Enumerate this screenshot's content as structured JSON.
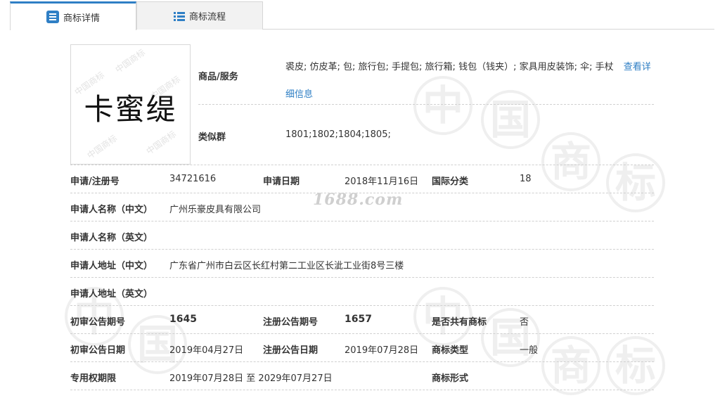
{
  "tabs": [
    {
      "label": "商标详情",
      "active": true
    },
    {
      "label": "商标流程",
      "active": false
    }
  ],
  "logo": {
    "text": "卡蜜缇",
    "watermark": "中国商标"
  },
  "background_watermark": [
    "中",
    "国",
    "商",
    "标"
  ],
  "site_watermark": "1688.com",
  "goods": {
    "label": "商品/服务",
    "value": "裘皮; 仿皮革; 包; 旅行包; 手提包; 旅行箱; 钱包（钱夹）; 家具用皮装饰; 伞; 手杖",
    "link": "查看详细信息"
  },
  "similar_group": {
    "label": "类似群",
    "value": "1801;1802;1804;1805;"
  },
  "rows": {
    "reg_no": {
      "label": "申请/注册号",
      "value": "34721616"
    },
    "apply_date": {
      "label": "申请日期",
      "value": "2018年11月16日"
    },
    "intl_class": {
      "label": "国际分类",
      "value": "18"
    },
    "applicant_cn": {
      "label": "申请人名称（中文）",
      "value": "广州乐豪皮具有限公司"
    },
    "applicant_en": {
      "label": "申请人名称（英文）",
      "value": ""
    },
    "address_cn": {
      "label": "申请人地址（中文）",
      "value": "广东省广州市白云区长红村第二工业区长泚工业街8号三楼"
    },
    "address_en": {
      "label": "申请人地址（英文）",
      "value": ""
    },
    "prelim_issue": {
      "label": "初审公告期号",
      "value": "1645"
    },
    "reg_issue": {
      "label": "注册公告期号",
      "value": "1657"
    },
    "shared": {
      "label": "是否共有商标",
      "value": "否"
    },
    "prelim_date": {
      "label": "初审公告日期",
      "value": "2019年04月27日"
    },
    "reg_date": {
      "label": "注册公告日期",
      "value": "2019年07月28日"
    },
    "tm_type": {
      "label": "商标类型",
      "value": "一般"
    },
    "exclusive_period": {
      "label": "专用权期限",
      "value": "2019年07月28日 至 2029年07月27日"
    },
    "tm_form": {
      "label": "商标形式",
      "value": ""
    }
  },
  "colors": {
    "accent": "#2f7fc5",
    "link": "#2d7ec4"
  }
}
